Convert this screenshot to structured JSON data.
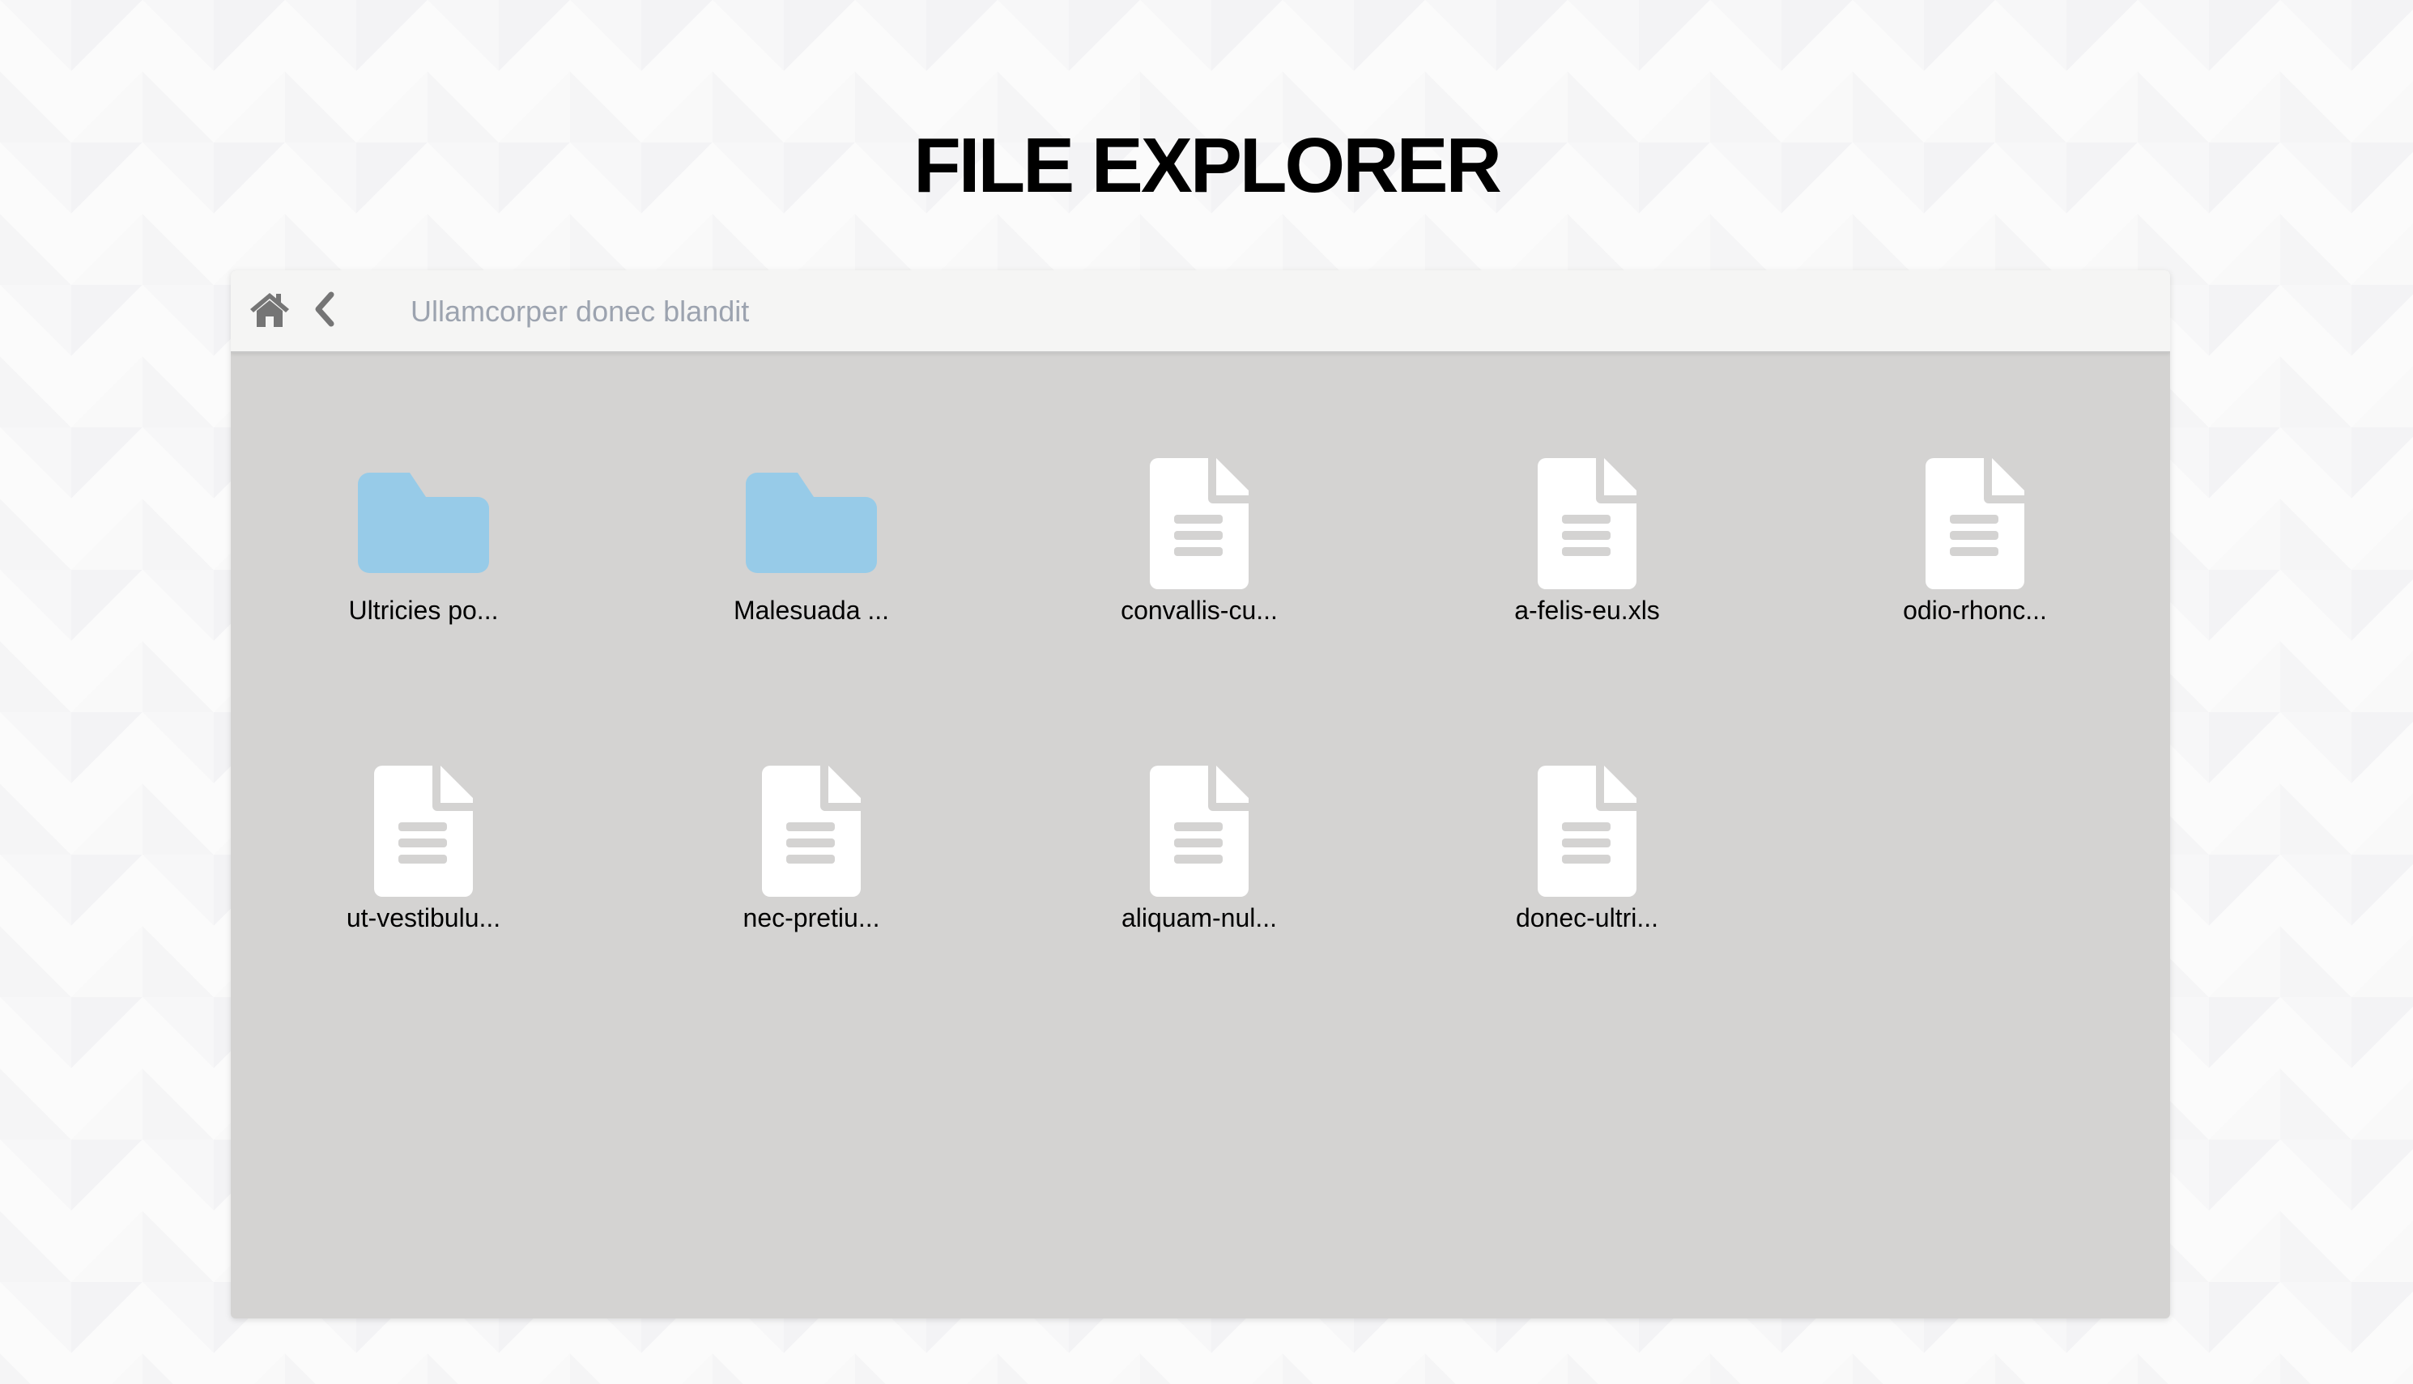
{
  "title": "FILE EXPLORER",
  "toolbar": {
    "home_icon": "home-icon",
    "back_icon": "chevron-left-icon",
    "path": "Ullamcorper donec blandit"
  },
  "colors": {
    "folder": "#97cbe8",
    "file": "#ffffff",
    "panel": "#d4d3d2",
    "toolbar": "#f5f5f4"
  },
  "items": [
    {
      "type": "folder",
      "name": "Ultricies po..."
    },
    {
      "type": "folder",
      "name": "Malesuada ..."
    },
    {
      "type": "file",
      "name": "convallis-cu..."
    },
    {
      "type": "file",
      "name": "a-felis-eu.xls"
    },
    {
      "type": "file",
      "name": "odio-rhonc..."
    },
    {
      "type": "file",
      "name": "ut-vestibulu..."
    },
    {
      "type": "file",
      "name": "nec-pretiu..."
    },
    {
      "type": "file",
      "name": "aliquam-nul..."
    },
    {
      "type": "file",
      "name": "donec-ultri..."
    }
  ]
}
